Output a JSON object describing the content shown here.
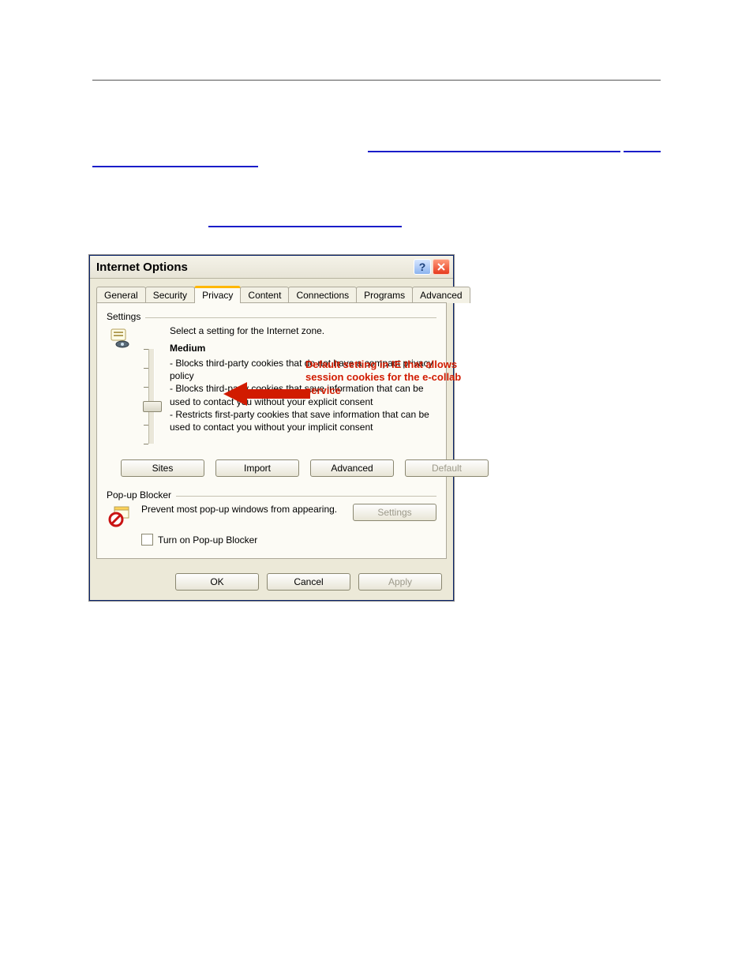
{
  "dialog": {
    "title": "Internet Options",
    "tabs": [
      "General",
      "Security",
      "Privacy",
      "Content",
      "Connections",
      "Programs",
      "Advanced"
    ],
    "active_tab": "Privacy",
    "settings": {
      "group_label": "Settings",
      "prompt": "Select a setting for the Internet zone.",
      "level": "Medium",
      "bullets": "- Blocks third-party cookies that do not have a compact privacy policy\n- Blocks third-party cookies that save information that can be used to contact you without your explicit consent\n- Restricts first-party cookies that save information that can be used to contact you without your implicit consent",
      "buttons": {
        "sites": "Sites",
        "import": "Import",
        "advanced": "Advanced",
        "default": "Default"
      }
    },
    "popup": {
      "group_label": "Pop-up Blocker",
      "text": "Prevent most pop-up windows from appearing.",
      "settings_btn": "Settings",
      "checkbox_label": "Turn on Pop-up Blocker"
    },
    "footer": {
      "ok": "OK",
      "cancel": "Cancel",
      "apply": "Apply"
    }
  },
  "annotation": {
    "text": "Default setting in IE that allows session cookies for the e-collab service"
  }
}
